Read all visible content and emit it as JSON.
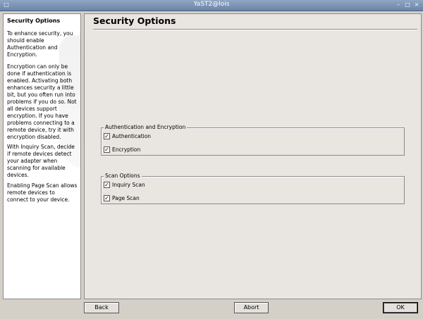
{
  "window": {
    "title": "YaST2@lois"
  },
  "help": {
    "title": "Security Options",
    "paragraphs": [
      "To enhance security, you should enable Authentication and Encryption.",
      "Encryption can only be done if authentication is enabled. Activating both enhances security a little bit, but you often run into problems if you do so. Not all devices support encryption. If you have problems connecting to a remote device, try it with encryption disabled.",
      "With Inquiry Scan, decide if remote devices detect your adapter when scanning for available devices.",
      "Enabling Page Scan allows remote devices to connect to your device."
    ]
  },
  "main": {
    "title": "Security Options",
    "auth_group": {
      "legend": "Authentication and Encryption",
      "authentication": {
        "label": "Authentication",
        "checked": true
      },
      "encryption": {
        "label": "Encryption",
        "checked": true
      }
    },
    "scan_group": {
      "legend": "Scan Options",
      "inquiry": {
        "label": "Inquiry Scan",
        "checked": true
      },
      "page": {
        "label": "Page Scan",
        "checked": true
      }
    }
  },
  "buttons": {
    "back": "Back",
    "abort": "Abort",
    "ok": "OK"
  },
  "glyphs": {
    "check": "✓",
    "minimize": "–",
    "maximize": "□",
    "close": "×"
  }
}
